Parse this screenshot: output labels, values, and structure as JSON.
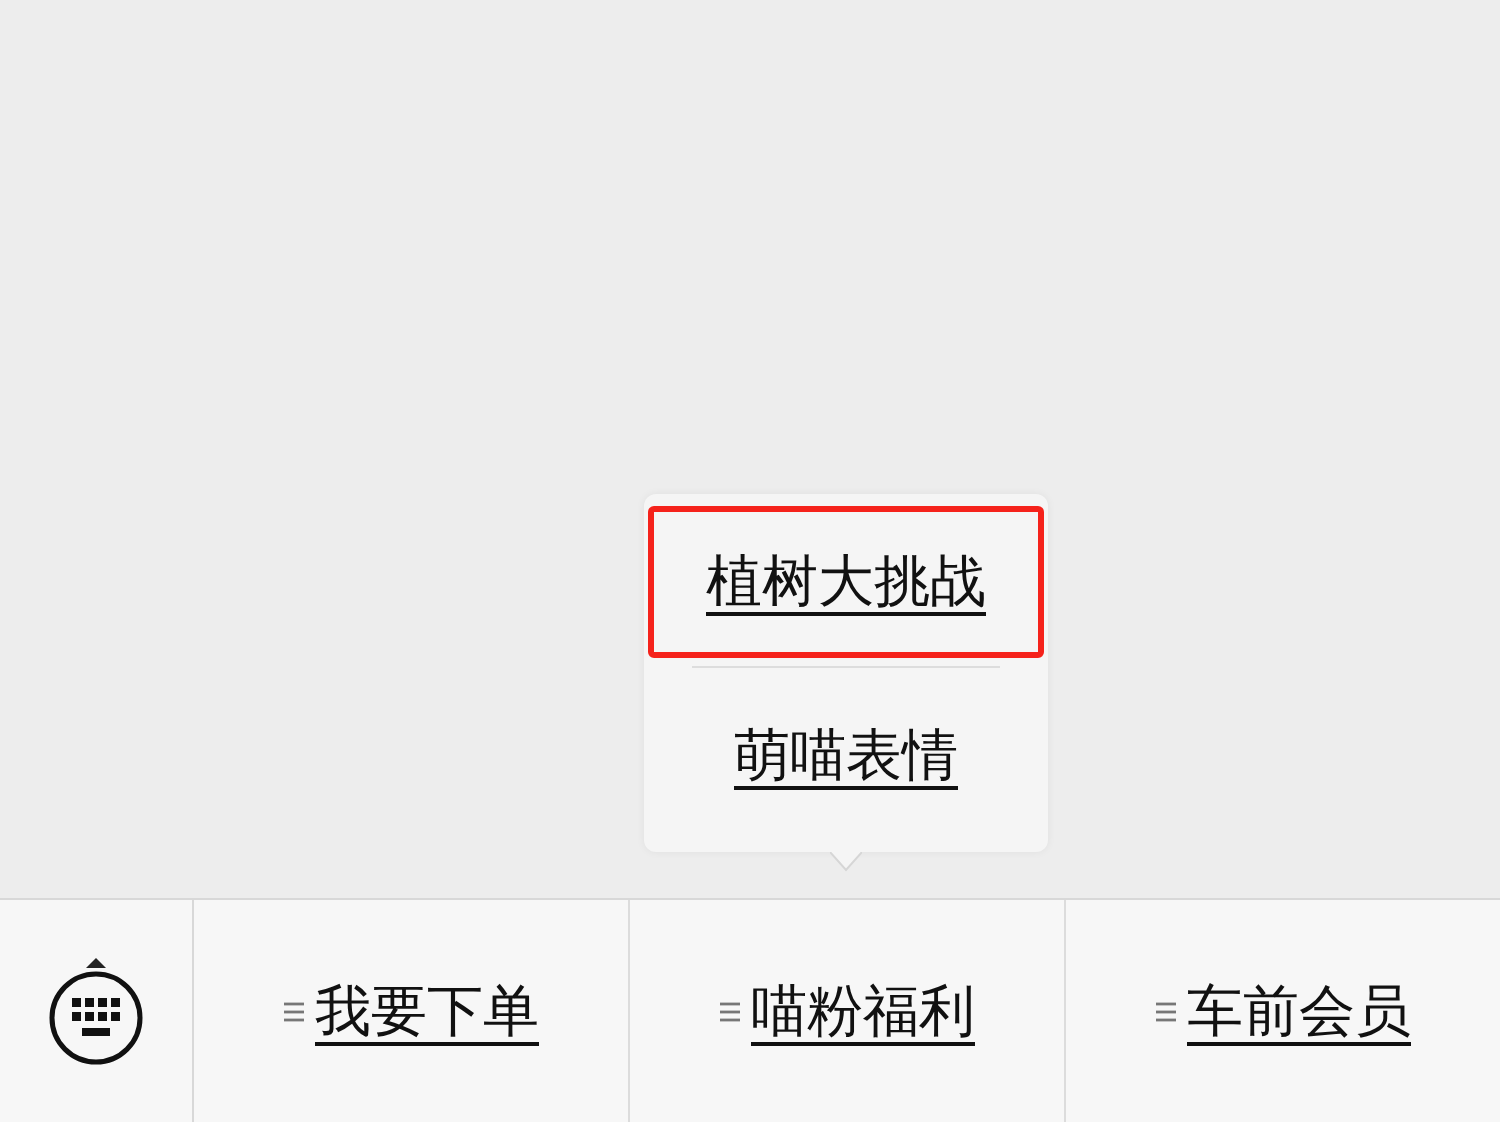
{
  "submenu": {
    "items": [
      {
        "label": "植树大挑战",
        "selected": true
      },
      {
        "label": "萌喵表情",
        "selected": false
      }
    ]
  },
  "menu_bar": {
    "items": [
      {
        "label": "我要下单",
        "expanded": false
      },
      {
        "label": "喵粉福利",
        "expanded": true
      },
      {
        "label": "车前会员",
        "expanded": false
      }
    ]
  }
}
